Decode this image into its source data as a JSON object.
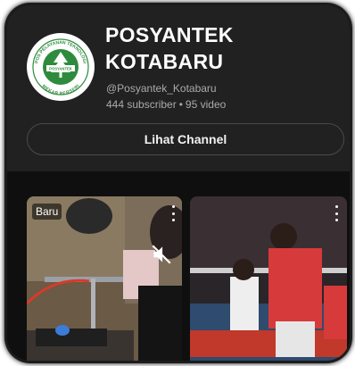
{
  "channel": {
    "name": "POSYANTEK KOTABARU",
    "handle": "@Posyantek_Kotabaru",
    "subscribers": "444 subscriber",
    "separator": "•",
    "videos": "95 video",
    "view_button_label": "Lihat Channel",
    "logo_text_top": "POS PELAYANAN TEKNOLOGI",
    "logo_text_center": "POSYANTEK",
    "logo_text_bottom": "MEKAR BERSERI"
  },
  "shorts": [
    {
      "badge": "Baru",
      "menu_icon": "more-vert-icon",
      "overlay_icon": "volume-off-icon"
    },
    {
      "menu_icon": "more-vert-icon"
    }
  ],
  "colors": {
    "background": "#0f0f0f",
    "header": "#212121",
    "text_primary": "#ffffff",
    "text_secondary": "#aaaaaa",
    "logo_green": "#2e8b3d"
  }
}
